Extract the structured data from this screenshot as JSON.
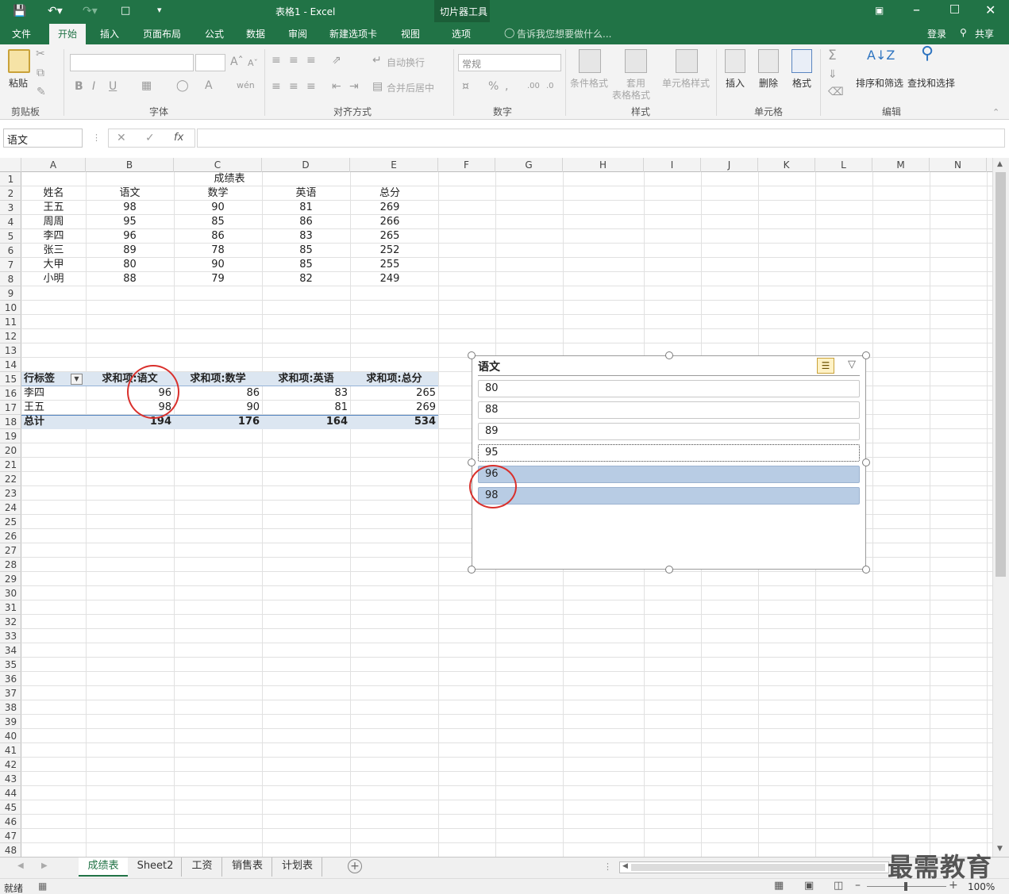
{
  "window": {
    "title": "表格1 - Excel",
    "context_tool": "切片器工具",
    "tabs": [
      "文件",
      "开始",
      "插入",
      "页面布局",
      "公式",
      "数据",
      "审阅",
      "新建选项卡",
      "视图",
      "选项"
    ],
    "tell_me": "告诉我您想要做什么...",
    "login": "登录",
    "share": "共享"
  },
  "ribbon": {
    "paste": "粘贴",
    "clipboard": "剪贴板",
    "font": "字体",
    "wrap": "自动换行",
    "merge": "合并后居中",
    "align": "对齐方式",
    "numfmt": "常规",
    "number": "数字",
    "cond_format": "条件格式",
    "table_format_1": "套用",
    "table_format_2": "表格格式",
    "cell_style": "单元格样式",
    "styles": "样式",
    "insert": "插入",
    "delete": "删除",
    "format": "格式",
    "cells": "单元格",
    "sort_filter": "排序和筛选",
    "find_select": "查找和选择",
    "editing": "编辑"
  },
  "formula_bar": {
    "name_box": "语文",
    "fx": "fx",
    "content": ""
  },
  "columns": [
    "A",
    "B",
    "C",
    "D",
    "E",
    "F",
    "G",
    "H",
    "I",
    "J",
    "K",
    "L",
    "M",
    "N"
  ],
  "rows_count": 48,
  "table": {
    "title": "成绩表",
    "headers": [
      "姓名",
      "语文",
      "数学",
      "英语",
      "总分"
    ],
    "rows": [
      [
        "王五",
        "98",
        "90",
        "81",
        "269"
      ],
      [
        "周周",
        "95",
        "85",
        "86",
        "266"
      ],
      [
        "李四",
        "96",
        "86",
        "83",
        "265"
      ],
      [
        "张三",
        "89",
        "78",
        "85",
        "252"
      ],
      [
        "大甲",
        "80",
        "90",
        "85",
        "255"
      ],
      [
        "小明",
        "88",
        "79",
        "82",
        "249"
      ]
    ]
  },
  "pivot": {
    "headers": [
      "行标签",
      "求和项:语文",
      "求和项:数学",
      "求和项:英语",
      "求和项:总分"
    ],
    "rows": [
      [
        "李四",
        "96",
        "86",
        "83",
        "265"
      ],
      [
        "王五",
        "98",
        "90",
        "81",
        "269"
      ]
    ],
    "total": [
      "总计",
      "194",
      "176",
      "164",
      "534"
    ]
  },
  "slicer": {
    "title": "语文",
    "items": [
      {
        "label": "80",
        "selected": false
      },
      {
        "label": "88",
        "selected": false
      },
      {
        "label": "89",
        "selected": false
      },
      {
        "label": "95",
        "selected": false
      },
      {
        "label": "96",
        "selected": true
      },
      {
        "label": "98",
        "selected": true
      }
    ]
  },
  "sheets": [
    "成绩表",
    "Sheet2",
    "工资",
    "销售表",
    "计划表"
  ],
  "active_sheet": "成绩表",
  "status": {
    "ready": "就绪",
    "zoom": "100%"
  },
  "watermark": "最需教育",
  "colors": {
    "accent": "#217346",
    "pivot_band": "#dce6f1",
    "slicer_selected": "#b8cce4",
    "annotation": "#d9302c"
  }
}
